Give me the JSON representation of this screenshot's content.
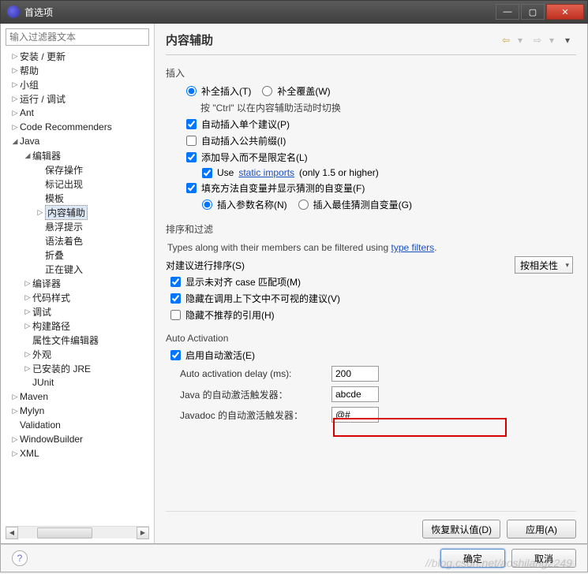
{
  "window": {
    "title": "首选项",
    "min": "—",
    "max": "▢",
    "close": "✕"
  },
  "filter_placeholder": "输入过滤器文本",
  "tree": [
    {
      "d": 0,
      "a": "▷",
      "t": "安装 / 更新"
    },
    {
      "d": 0,
      "a": "▷",
      "t": "帮助"
    },
    {
      "d": 0,
      "a": "▷",
      "t": "小组"
    },
    {
      "d": 0,
      "a": "▷",
      "t": "运行 / 调试"
    },
    {
      "d": 0,
      "a": "▷",
      "t": "Ant"
    },
    {
      "d": 0,
      "a": "▷",
      "t": "Code Recommenders"
    },
    {
      "d": 0,
      "a": "◢",
      "t": "Java"
    },
    {
      "d": 1,
      "a": "◢",
      "t": "编辑器"
    },
    {
      "d": 2,
      "a": "",
      "t": "保存操作"
    },
    {
      "d": 2,
      "a": "",
      "t": "标记出现"
    },
    {
      "d": 2,
      "a": "",
      "t": "模板"
    },
    {
      "d": 2,
      "a": "▷",
      "t": "内容辅助",
      "sel": true
    },
    {
      "d": 2,
      "a": "",
      "t": "悬浮提示"
    },
    {
      "d": 2,
      "a": "",
      "t": "语法着色"
    },
    {
      "d": 2,
      "a": "",
      "t": "折叠"
    },
    {
      "d": 2,
      "a": "",
      "t": "正在键入"
    },
    {
      "d": 1,
      "a": "▷",
      "t": "编译器"
    },
    {
      "d": 1,
      "a": "▷",
      "t": "代码样式"
    },
    {
      "d": 1,
      "a": "▷",
      "t": "调试"
    },
    {
      "d": 1,
      "a": "▷",
      "t": "构建路径"
    },
    {
      "d": 1,
      "a": "",
      "t": "属性文件编辑器"
    },
    {
      "d": 1,
      "a": "▷",
      "t": "外观"
    },
    {
      "d": 1,
      "a": "▷",
      "t": "已安装的 JRE"
    },
    {
      "d": 1,
      "a": "",
      "t": "JUnit"
    },
    {
      "d": 0,
      "a": "▷",
      "t": "Maven"
    },
    {
      "d": 0,
      "a": "▷",
      "t": "Mylyn"
    },
    {
      "d": 0,
      "a": "",
      "t": "Validation"
    },
    {
      "d": 0,
      "a": "▷",
      "t": "WindowBuilder"
    },
    {
      "d": 0,
      "a": "▷",
      "t": "XML"
    }
  ],
  "page_title": "内容辅助",
  "insert": {
    "group": "插入",
    "r1a": "补全插入(T)",
    "r1b": "补全覆盖(W)",
    "hint": "按 \"Ctrl\" 以在内容辅助活动时切换",
    "c1": "自动插入单个建议(P)",
    "c2": "自动插入公共前缀(I)",
    "c3": "添加导入而不是限定名(L)",
    "c3a_pre": "Use ",
    "c3a_link": "static imports",
    "c3a_post": " (only 1.5 or higher)",
    "c4": "填充方法自变量并显示猜测的自变量(F)",
    "r2a": "插入参数名称(N)",
    "r2b": "插入最佳猜测自变量(G)"
  },
  "sort": {
    "group": "排序和过滤",
    "desc_pre": "Types along with their members can be filtered using ",
    "desc_link": "type filters",
    "desc_post": ".",
    "lab": "对建议进行排序(S)",
    "combo": "按相关性",
    "c1": "显示未对齐 case 匹配项(M)",
    "c2": "隐藏在调用上下文中不可视的建议(V)",
    "c3": "隐藏不推荐的引用(H)"
  },
  "auto": {
    "group": "Auto Activation",
    "c1": "启用自动激活(E)",
    "delay_lab": "Auto activation delay (ms):",
    "delay_val": "200",
    "java_lab": "Java 的自动激活触发器：",
    "java_val": "abcde",
    "jdoc_lab": "Javadoc 的自动激活触发器：",
    "jdoc_val": "@#"
  },
  "buttons": {
    "restore": "恢复默认值(D)",
    "apply": "应用(A)",
    "ok": "确定",
    "cancel": "取消"
  },
  "watermark": "//blog.csdn.net/aoshilang2249"
}
